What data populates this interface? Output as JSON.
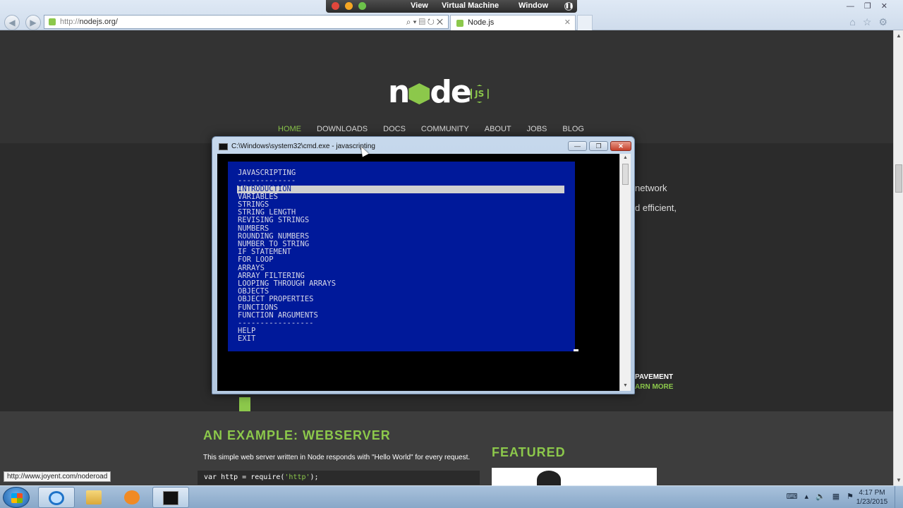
{
  "vm_menu": {
    "items": [
      "View",
      "Virtual Machine",
      "Window"
    ],
    "traffic_light_colors": [
      "#e2473c",
      "#f5a623",
      "#6cc24a"
    ]
  },
  "browser": {
    "address_protocol": "http://",
    "address_host": "nodejs.org/",
    "tab_title": "Node.js",
    "back_icon": "back-arrow-icon",
    "forward_icon": "forward-arrow-icon"
  },
  "site": {
    "logo_text": "node",
    "logo_badge": "JS",
    "nav": [
      "HOME",
      "DOWNLOADS",
      "DOCS",
      "COMMUNITY",
      "ABOUT",
      "JOBS",
      "BLOG"
    ],
    "active_nav": "HOME",
    "hero_partial_1": "network",
    "hero_partial_2": "d efficient,",
    "pavement_1": "PAVEMENT",
    "pavement_2": "ARN MORE",
    "example_title": "AN EXAMPLE: WEBSERVER",
    "example_desc": "This simple web server written in Node responds with \"Hello World\" for every request.",
    "code_prefix": "var http = require(",
    "code_string": "'http'",
    "code_suffix": ");",
    "featured_title": "FEATURED",
    "status_link": "http://www.joyent.com/noderoad",
    "accent_color": "#8cc84b"
  },
  "cmd": {
    "title": "C:\\Windows\\system32\\cmd.exe - javascripting",
    "menu_title": "JAVASCRIPTING",
    "menu_rule": "-------------",
    "items": [
      "INTRODUCTION",
      "VARIABLES",
      "STRINGS",
      "STRING LENGTH",
      "REVISING STRINGS",
      "NUMBERS",
      "ROUNDING NUMBERS",
      "NUMBER TO STRING",
      "IF STATEMENT",
      "FOR LOOP",
      "ARRAYS",
      "ARRAY FILTERING",
      "LOOPING THROUGH ARRAYS",
      "OBJECTS",
      "OBJECT PROPERTIES",
      "FUNCTIONS",
      "FUNCTION ARGUMENTS"
    ],
    "selected_item": "INTRODUCTION",
    "footer_rule": "-----------------",
    "footer_items": [
      "HELP",
      "EXIT"
    ],
    "menu_bg_color": "#00199a"
  },
  "taskbar": {
    "time": "4:17 PM",
    "date": "1/23/2015",
    "pinned": [
      "internet-explorer-icon",
      "file-explorer-icon",
      "media-player-icon",
      "cmd-icon"
    ]
  }
}
